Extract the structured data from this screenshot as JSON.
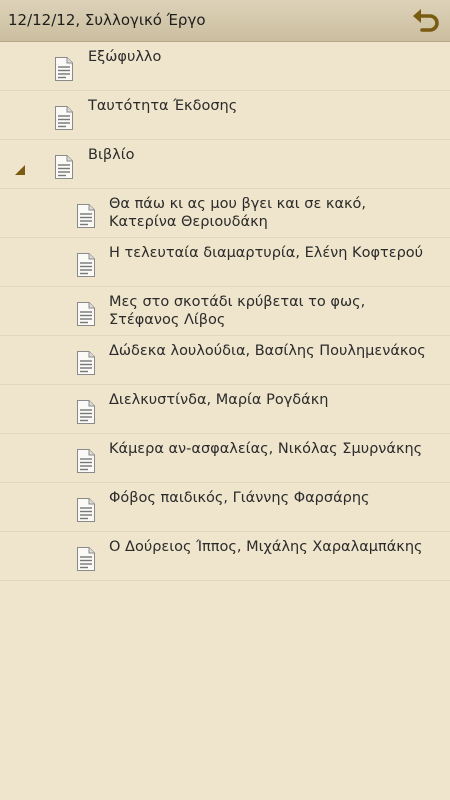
{
  "header": {
    "title": "12/12/12, Συλλογικό Έργο",
    "back_icon": "undo-arrow-icon"
  },
  "colors": {
    "background": "#efe4cc",
    "header": "#d6cab0",
    "divider": "#e3d7bd",
    "accent": "#7a5b12"
  },
  "items": [
    {
      "label": "Εξώφυλλο",
      "level": 0,
      "icon": "document-icon"
    },
    {
      "label": "Ταυτότητα Έκδοσης",
      "level": 0,
      "icon": "document-icon"
    },
    {
      "label": "Βιβλίο",
      "level": 0,
      "icon": "document-icon",
      "expanded": true
    },
    {
      "label": "Θα πάω κι ας μου βγει και σε κακό, Κατερίνα Θεριουδάκη",
      "level": 1,
      "icon": "document-icon"
    },
    {
      "label": "Η τελευταία διαμαρτυρία, Ελένη Κοφτερού",
      "level": 1,
      "icon": "document-icon"
    },
    {
      "label": "Μες στο σκοτάδι κρύβεται το φως, Στέφανος Λίβος",
      "level": 1,
      "icon": "document-icon"
    },
    {
      "label": "Δώδεκα λουλούδια, Βασίλης Πουλημενάκος",
      "level": 1,
      "icon": "document-icon"
    },
    {
      "label": "Διελκυστίνδα, Μαρία Ρογδάκη",
      "level": 1,
      "icon": "document-icon"
    },
    {
      "label": "Κάμερα αν-ασφαλείας, Νικόλας Σμυρνάκης",
      "level": 1,
      "icon": "document-icon"
    },
    {
      "label": "Φόβος παιδικός, Γιάννης Φαρσάρης",
      "level": 1,
      "icon": "document-icon"
    },
    {
      "label": "Ο Δούρειος Ίππος, Μιχάλης Χαραλαμπάκης",
      "level": 1,
      "icon": "document-icon"
    }
  ]
}
